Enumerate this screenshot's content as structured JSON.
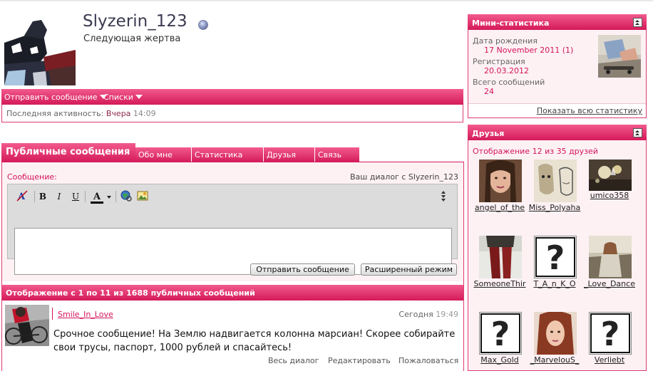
{
  "profile": {
    "username": "Slyzerin_123",
    "user_title": "Следующая жертва",
    "actions": {
      "send_message": "Отправить сообщение",
      "lists": "Списки"
    },
    "activity_label": "Последняя активность:",
    "activity_day": "Вчера",
    "activity_time": "14:09"
  },
  "tabs": [
    {
      "label": "Публичные сообщения",
      "active": true
    },
    {
      "label": "Обо мне"
    },
    {
      "label": "Статистика"
    },
    {
      "label": "Друзья"
    },
    {
      "label": "Связь"
    }
  ],
  "editor": {
    "message_label": "Сообщение:",
    "dialog_label": "Ваш диалог с Slyzerin_123",
    "send_button": "Отправить сообщение",
    "advanced_button": "Расширенный режим",
    "toolbar": {
      "bold": "B",
      "italic": "I",
      "underline": "U",
      "font_color": "A"
    }
  },
  "messages": {
    "header": "Отображение с 1 по 11 из 1688 публичных сообщений",
    "items": [
      {
        "author": "Smile_In_Love",
        "date": "Сегодня",
        "time": "19:49",
        "text": "Срочное сообщение! На Землю надвигается колонна марсиан! Скорее собирайте свои трусы, паспорт, 1000 рублей и спасайтесь!",
        "actions": {
          "dialog": "Весь диалог",
          "edit": "Редактировать",
          "report": "Пожаловаться"
        }
      }
    ]
  },
  "mini_stats": {
    "title": "Мини-статистика",
    "items": [
      {
        "label": "Дата рождения",
        "value": "17 November 2011 (1)"
      },
      {
        "label": "Регистрация",
        "value": "20.03.2012"
      },
      {
        "label": "Всего сообщений",
        "value": "24"
      }
    ],
    "show_all": "Показать всю статистику"
  },
  "friends": {
    "title": "Друзья",
    "count_text": "Отображение 12 из 35 друзей",
    "items": [
      "angel_of_the",
      "Miss_Polyaha",
      "umico358",
      "SomeoneThir",
      "T_A_n_K_O",
      "_Love_Dance",
      "Max_Gold",
      "_MarvelouS_",
      "Verliebt"
    ]
  },
  "colors": {
    "accent": "#d41a5a",
    "accent_light": "#f25a8d",
    "panel_bg": "#fdf1f4"
  }
}
